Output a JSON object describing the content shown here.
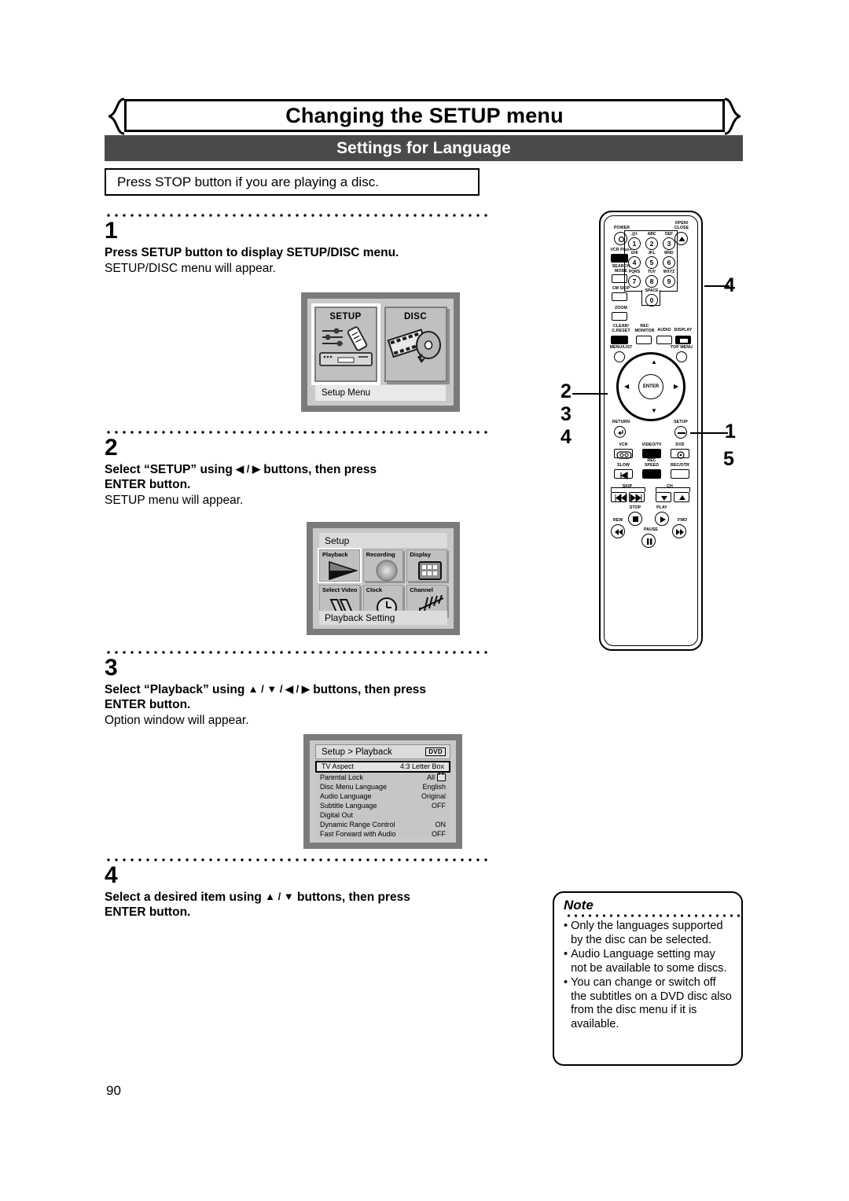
{
  "page": {
    "title": "Changing the SETUP menu",
    "section": "Settings for Language",
    "prenote": "Press STOP button if you are playing a disc.",
    "number": "90"
  },
  "steps": [
    {
      "num": "1",
      "head": "Press SETUP button to display SETUP/DISC menu.",
      "sub": "SETUP/DISC menu will appear."
    },
    {
      "num": "2",
      "head_pre": "Select “SETUP” using ",
      "head_arrows": "◀ / ▶",
      "head_post": " buttons, then press",
      "head_line2": "ENTER button.",
      "sub": "SETUP menu will appear."
    },
    {
      "num": "3",
      "head_pre": "Select “Playback” using ",
      "head_arrows": "▲ / ▼ / ◀ / ▶",
      "head_post": " buttons, then press",
      "head_line2": "ENTER button.",
      "sub": "Option window will appear."
    },
    {
      "num": "4",
      "head_pre": "Select a desired item using ",
      "head_arrows": "▲ / ▼",
      "head_post": " buttons, then press",
      "head_line2": "ENTER button.",
      "sub": ""
    }
  ],
  "screen_setup_disc": {
    "cards": [
      {
        "label": "SETUP",
        "icon": "sliders-remote-vcr-icon",
        "selected": true
      },
      {
        "label": "DISC",
        "icon": "film-disc-icon",
        "selected": false
      }
    ],
    "caption": "Setup Menu"
  },
  "screen_setup_grid": {
    "title": "Setup",
    "cells": [
      {
        "label": "Playback",
        "icon": "play-triangle-icon",
        "selected": true
      },
      {
        "label": "Recording",
        "icon": "record-circle-icon",
        "selected": false
      },
      {
        "label": "Display",
        "icon": "display-grid-icon",
        "selected": false
      },
      {
        "label": "Select\nVideo",
        "icon": "cables-icon",
        "selected": false
      },
      {
        "label": "Clock",
        "icon": "clock-icon",
        "selected": false
      },
      {
        "label": "Channel",
        "icon": "antenna-icon",
        "selected": false
      }
    ],
    "caption": "Playback Setting"
  },
  "screen_playback_table": {
    "title": "Setup > Playback",
    "badge": "DVD",
    "rows": [
      {
        "name": "TV Aspect",
        "value": "4:3 Letter Box",
        "selected": true,
        "icon": ""
      },
      {
        "name": "Parental Lock",
        "value": "All",
        "selected": false,
        "icon": "lock-icon"
      },
      {
        "name": "Disc Menu Language",
        "value": "English",
        "selected": false,
        "icon": ""
      },
      {
        "name": "Audio Language",
        "value": "Original",
        "selected": false,
        "icon": ""
      },
      {
        "name": "Subtitle Language",
        "value": "OFF",
        "selected": false,
        "icon": ""
      },
      {
        "name": "Digital Out",
        "value": "",
        "selected": false,
        "icon": ""
      },
      {
        "name": "Dynamic Range Control",
        "value": "ON",
        "selected": false,
        "icon": ""
      },
      {
        "name": "Fast Forward with Audio",
        "value": "OFF",
        "selected": false,
        "icon": ""
      }
    ]
  },
  "note": {
    "title": "Note",
    "items": [
      "Only the languages supported by the disc can be selected.",
      "Audio Language setting may not be available to some discs.",
      "You can change or switch off the subtitles on a DVD disc also from the disc menu if it is available.",
      "•",
      "•",
      "•"
    ],
    "bullet": "•"
  },
  "remote": {
    "buttons": {
      "power": "POWER",
      "open_close": "OPEN/\nCLOSE",
      "vcr_plus": "VCR Plus+",
      "search_mode": "SEARCH\nMODE",
      "cm_skip": "CM SKIP",
      "zoom": "ZOOM",
      "clear_reset": "CLEAR/\nC.RESET",
      "rec_monitor": "REC\nMONITOR",
      "audio": "AUDIO",
      "display": "DISPLAY",
      "menu_list": "MENU/LIST",
      "top_menu": "TOP MENU",
      "enter": "ENTER",
      "return": "RETURN",
      "setup": "SETUP",
      "vcr": "VCR",
      "video_tv": "VIDEO/TV",
      "dvd": "DVD",
      "slow": "SLOW",
      "rec_speed": "REC\nSPEED",
      "rec_otr": "REC/OTR",
      "skip": "SKIP",
      "ch": "CH",
      "stop": "STOP",
      "play": "PLAY",
      "rew": "REW",
      "fwd": "FWD",
      "pause": "PAUSE"
    },
    "keypad": [
      {
        "digit": "1",
        "letters": ".@/:"
      },
      {
        "digit": "2",
        "letters": "ABC"
      },
      {
        "digit": "3",
        "letters": "DEF"
      },
      {
        "digit": "4",
        "letters": "GHI"
      },
      {
        "digit": "5",
        "letters": "JKL"
      },
      {
        "digit": "6",
        "letters": "MNO"
      },
      {
        "digit": "7",
        "letters": "PQRS"
      },
      {
        "digit": "8",
        "letters": "TUV"
      },
      {
        "digit": "9",
        "letters": "WXYZ"
      },
      {
        "digit": "0",
        "letters": "SPACE"
      }
    ],
    "callouts": {
      "keypad": "4",
      "nav_a": "2",
      "nav_b": "3",
      "nav_c": "4",
      "setup_a": "1",
      "setup_b": "5"
    }
  }
}
